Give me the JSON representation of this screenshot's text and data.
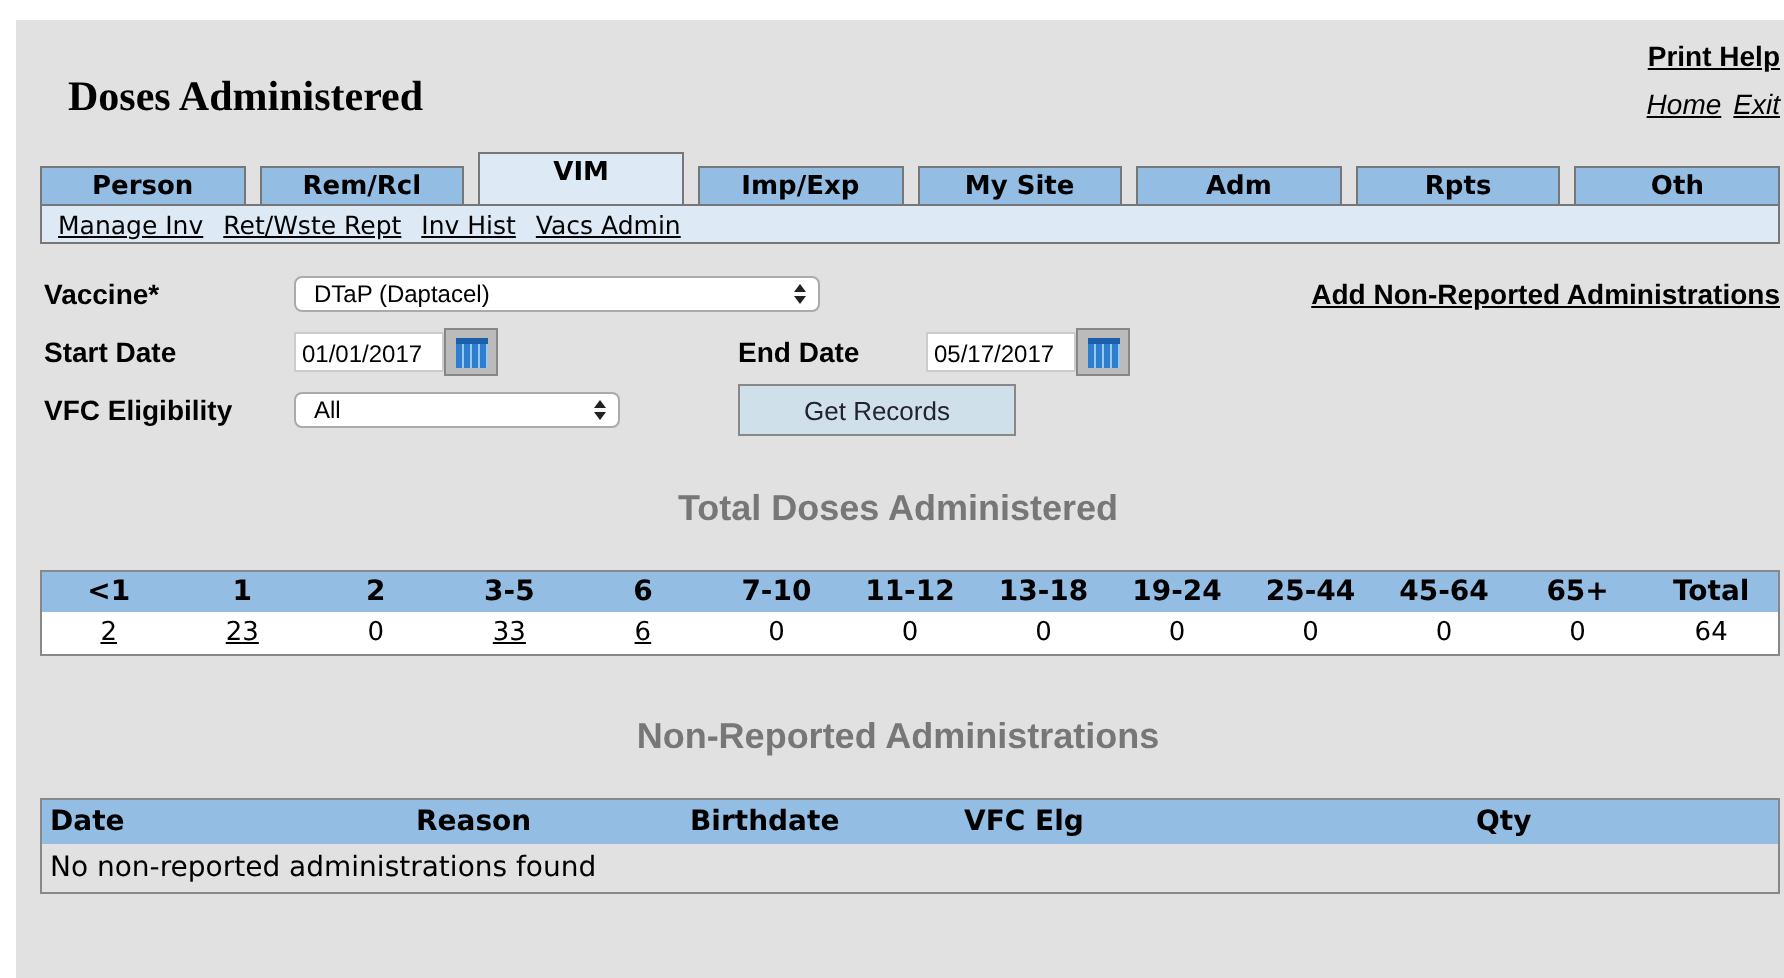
{
  "page_title": "Doses Administered",
  "print_help": "Print Help",
  "nav_links": [
    "Home",
    "Exit"
  ],
  "tabs": [
    {
      "label": "Person",
      "selected": false
    },
    {
      "label": "Rem/Rcl",
      "selected": false
    },
    {
      "label": "VIM",
      "selected": true
    },
    {
      "label": "Imp/Exp",
      "selected": false
    },
    {
      "label": "My Site",
      "selected": false
    },
    {
      "label": "Adm",
      "selected": false
    },
    {
      "label": "Rpts",
      "selected": false
    },
    {
      "label": "Oth",
      "selected": false
    }
  ],
  "subnav": [
    "Manage Inv",
    "Ret/Wste Rept",
    "Inv Hist",
    "Vacs Admin"
  ],
  "form": {
    "vaccine": {
      "label": "Vaccine*",
      "value": "DTaP (Daptacel)"
    },
    "start_date": {
      "label": "Start Date",
      "value": "01/01/2017"
    },
    "end_date": {
      "label": "End Date",
      "value": "05/17/2017"
    },
    "vfc": {
      "label": "VFC Eligibility",
      "value": "All"
    },
    "button": "Get Records",
    "add_link": "Add Non-Reported Administrations"
  },
  "totals": {
    "title": "Total Doses Administered",
    "columns": [
      "<1",
      "1",
      "2",
      "3-5",
      "6",
      "7-10",
      "11-12",
      "13-18",
      "19-24",
      "25-44",
      "45-64",
      "65+",
      "Total"
    ],
    "counts": [
      {
        "text": "2",
        "link": true
      },
      {
        "text": "23",
        "link": true
      },
      {
        "text": "0",
        "link": false
      },
      {
        "text": "33",
        "link": true
      },
      {
        "text": "6",
        "link": true
      },
      {
        "text": "0",
        "link": false
      },
      {
        "text": "0",
        "link": false
      },
      {
        "text": "0",
        "link": false
      },
      {
        "text": "0",
        "link": false
      },
      {
        "text": "0",
        "link": false
      },
      {
        "text": "0",
        "link": false
      },
      {
        "text": "0",
        "link": false
      },
      {
        "text": "64",
        "link": false
      }
    ]
  },
  "non_reported": {
    "title": "Non-Reported Administrations",
    "columns": [
      "Date",
      "Reason",
      "Birthdate",
      "VFC Elg",
      "Qty"
    ],
    "message": "No non-reported administrations found"
  }
}
